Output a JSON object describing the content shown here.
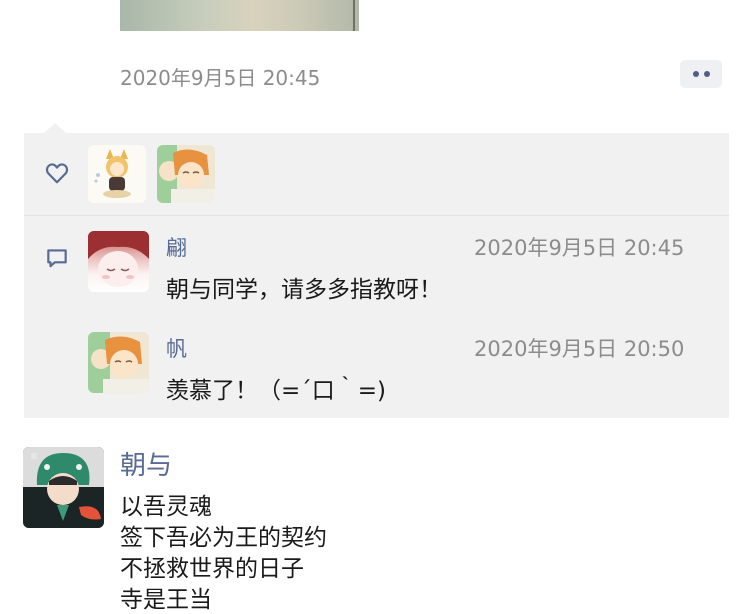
{
  "moment": {
    "timestamp": "2020年9月5日 20:45",
    "more_icon": "more-dots-icon"
  },
  "likes": {
    "icon": "heart-icon",
    "users": [
      {
        "avatar": "fox-girl-avatar"
      },
      {
        "avatar": "anime-boys-avatar"
      }
    ]
  },
  "comments": {
    "icon": "comment-icon",
    "items": [
      {
        "name": "翩",
        "time": "2020年9月5日 20:45",
        "text": "朝与同学，请多多指教呀！"
      },
      {
        "name": "帆",
        "time": "2020年9月5日 20:50",
        "text": "羡慕了！（=´口｀=)"
      }
    ]
  },
  "next_post": {
    "name": "朝与",
    "lines": [
      "以吾灵魂",
      "签下吾必为王的契约",
      "不拯救世界的日子",
      "寺是王当"
    ]
  }
}
